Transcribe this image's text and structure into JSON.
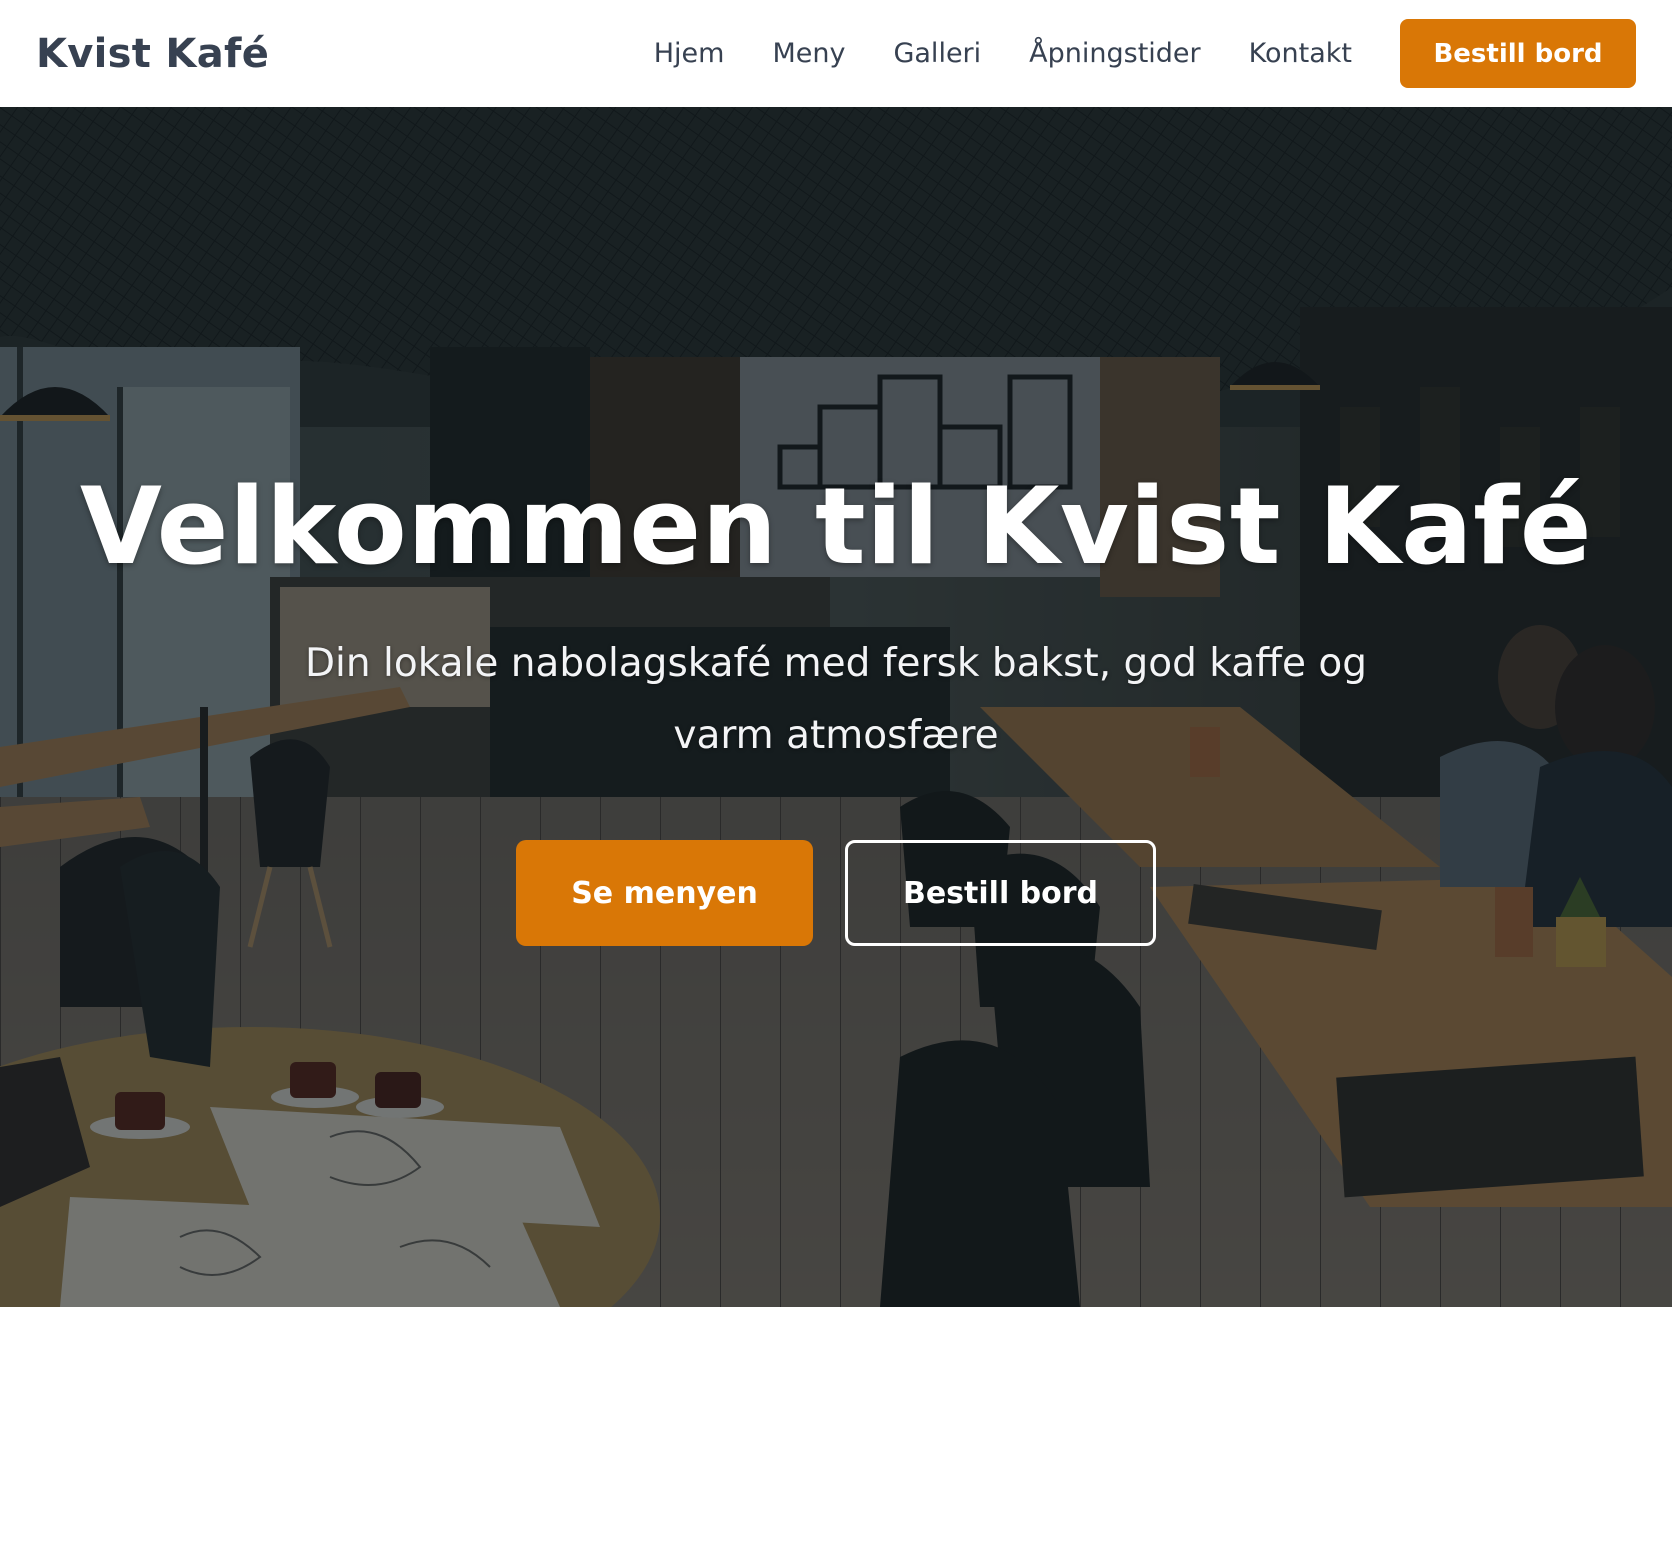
{
  "header": {
    "brand": "Kvist Kafé",
    "nav": [
      "Hjem",
      "Meny",
      "Galleri",
      "Åpningstider",
      "Kontakt"
    ],
    "cta_label": "Bestill bord"
  },
  "hero": {
    "title": "Velkommen til Kvist Kafé",
    "subtitle": "Din lokale nabolagskafé med fersk bakst, god kaffe og varm atmosfære",
    "primary_button": "Se menyen",
    "secondary_button": "Bestill bord"
  },
  "colors": {
    "accent": "#d97706",
    "text_dark": "#374151",
    "background": "#ffffff"
  }
}
